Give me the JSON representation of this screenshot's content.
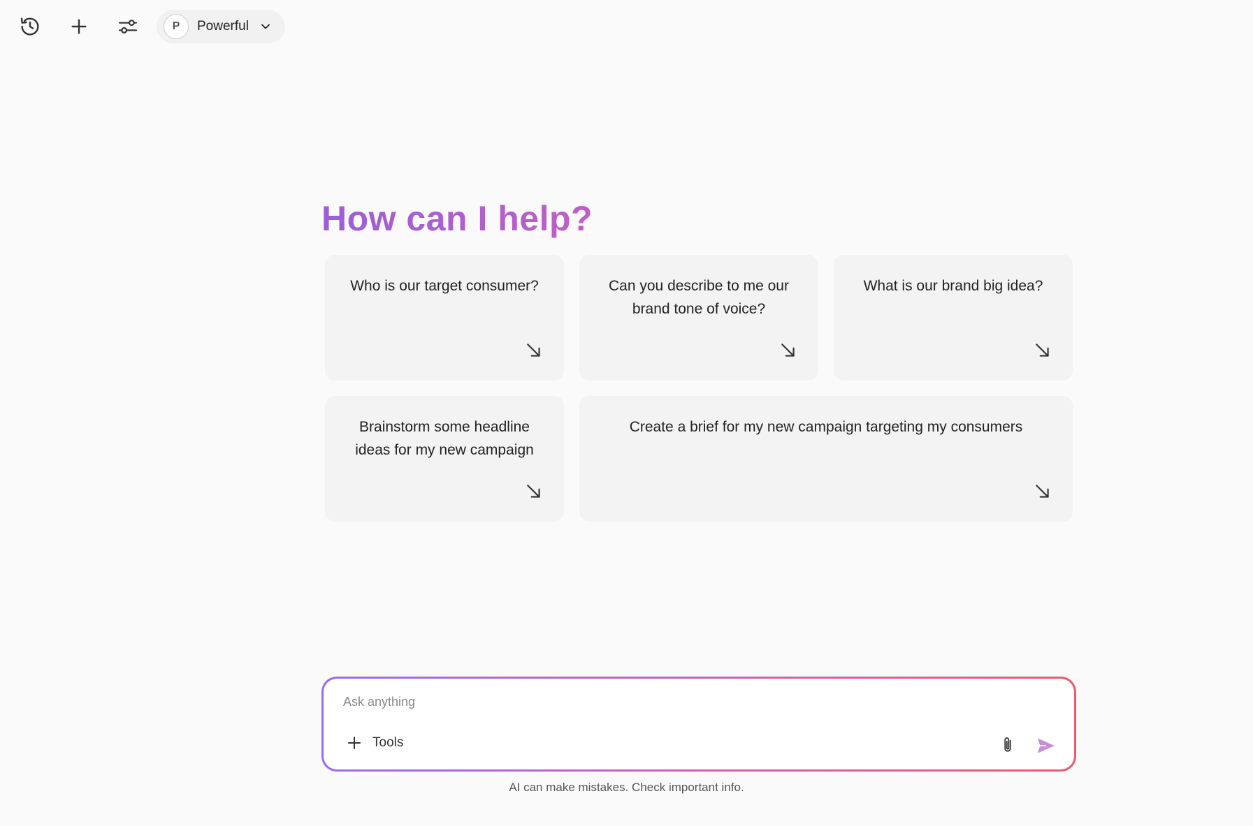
{
  "toolbar": {
    "history_icon": "history-icon",
    "new_chat_icon": "plus-icon",
    "settings_icon": "sliders-icon",
    "model": {
      "avatar_letter": "P",
      "name": "Powerful"
    }
  },
  "heading": "How can I help?",
  "suggestions": [
    {
      "text": "Who is our target consumer?"
    },
    {
      "text": "Can you describe to me our brand tone of voice?"
    },
    {
      "text": "What is our brand big idea?"
    },
    {
      "text": "Brainstorm some headline ideas for my new campaign"
    },
    {
      "text": "Create a brief for my new campaign targeting my consumers"
    }
  ],
  "composer": {
    "placeholder": "Ask anything",
    "tools_label": "Tools"
  },
  "disclaimer": "AI can make mistakes. Check important info.",
  "colors": {
    "heading_gradient_start": "#9b5fd6",
    "heading_gradient_end": "#c05fc4",
    "border_gradient_start": "#9b6cf0",
    "border_gradient_end": "#ee5a6c",
    "send_icon": "#c78fd4"
  }
}
